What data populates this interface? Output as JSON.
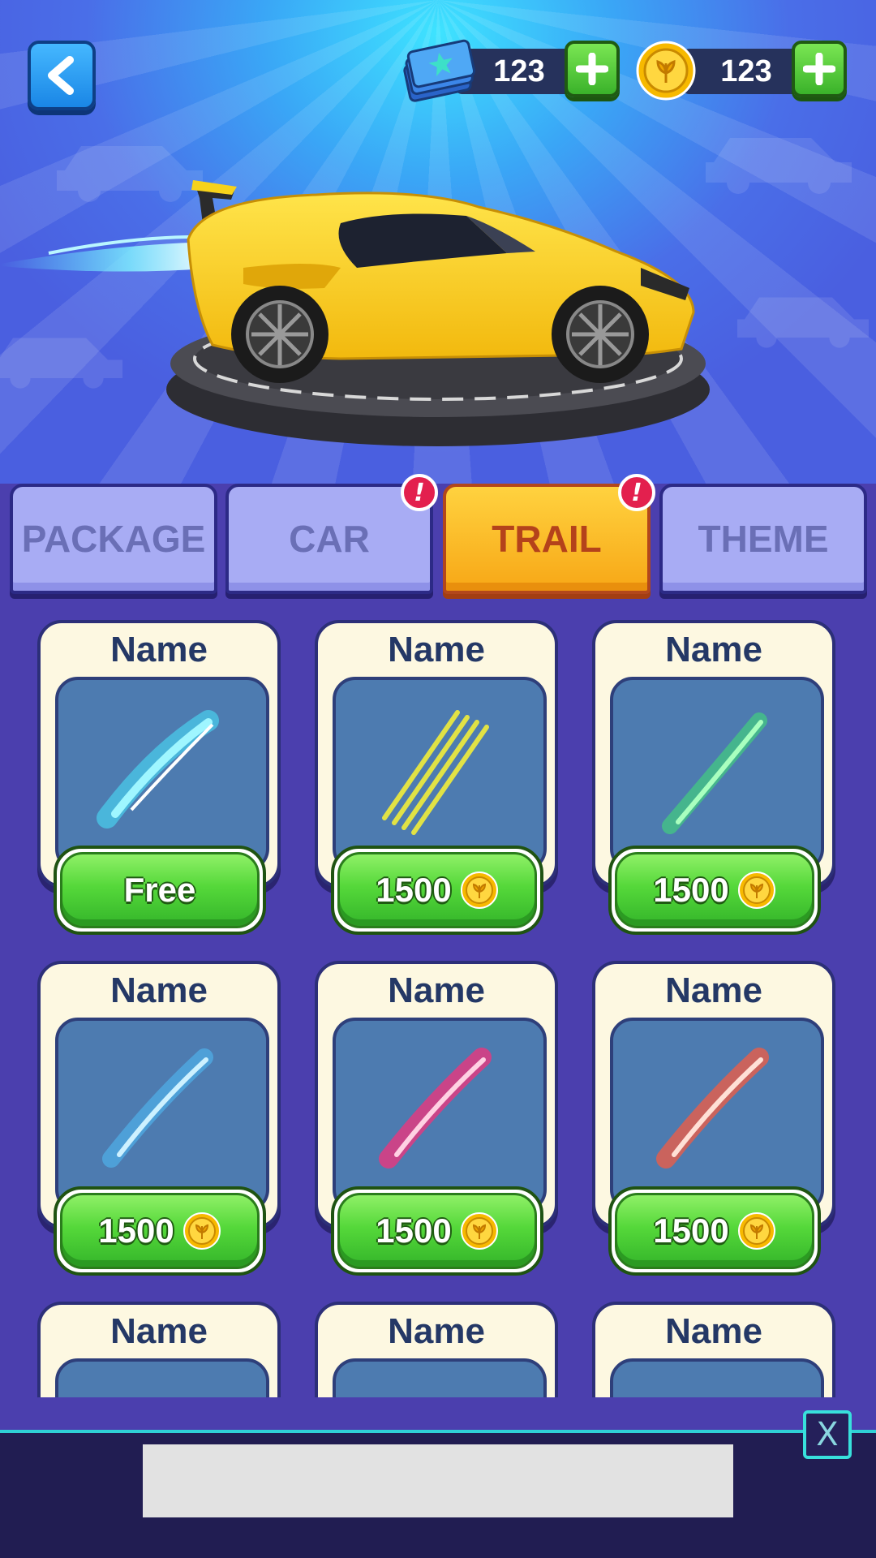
{
  "header": {
    "back_label": "back",
    "tickets": {
      "value": "123",
      "icon": "ticket-icon"
    },
    "coins": {
      "value": "123",
      "icon": "coin-icon"
    }
  },
  "showcase": {
    "item": "yellow-sports-car-with-blue-trail"
  },
  "tabs": [
    {
      "label": "PACKAGE",
      "active": false,
      "badge": ""
    },
    {
      "label": "CAR",
      "active": false,
      "badge": "!"
    },
    {
      "label": "TRAIL",
      "active": true,
      "badge": "!"
    },
    {
      "label": "THEME",
      "active": false,
      "badge": ""
    }
  ],
  "items": [
    {
      "name": "Name",
      "price": "Free",
      "currency": "",
      "trail_color": "#48e8ff"
    },
    {
      "name": "Name",
      "price": "1500",
      "currency": "coin-icon",
      "trail_color": "#f2ee3a"
    },
    {
      "name": "Name",
      "price": "1500",
      "currency": "coin-icon",
      "trail_color": "#3df06a"
    },
    {
      "name": "Name",
      "price": "1500",
      "currency": "coin-icon",
      "trail_color": "#4fc6ff"
    },
    {
      "name": "Name",
      "price": "1500",
      "currency": "coin-icon",
      "trail_color": "#ff2d78"
    },
    {
      "name": "Name",
      "price": "1500",
      "currency": "coin-icon",
      "trail_color": "#ff5a3a"
    },
    {
      "name": "Name",
      "price": "",
      "currency": "",
      "trail_color": ""
    },
    {
      "name": "Name",
      "price": "",
      "currency": "",
      "trail_color": ""
    },
    {
      "name": "Name",
      "price": "",
      "currency": "",
      "trail_color": ""
    }
  ],
  "ad": {
    "close_label": "X"
  },
  "colors": {
    "tab_active": "#f7a716",
    "tab_inactive": "#a8acf4",
    "buy_button": "#55d83a",
    "card_bg": "#fdf8e1",
    "page_bg": "#4b3fae"
  }
}
